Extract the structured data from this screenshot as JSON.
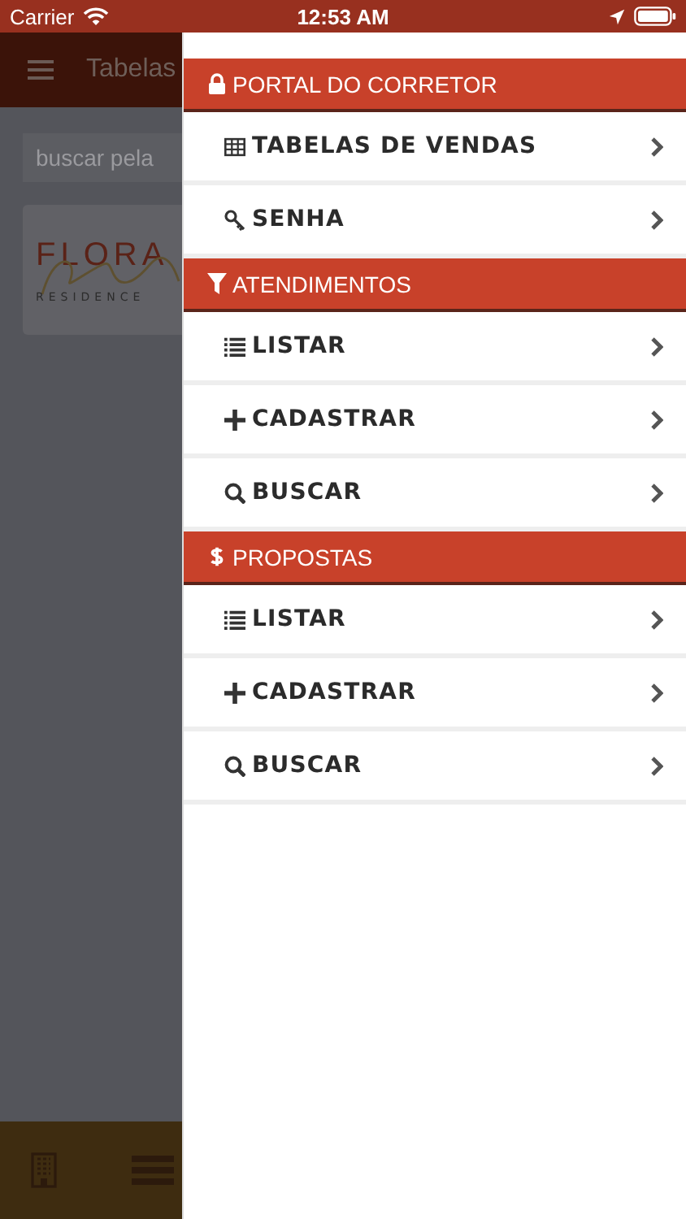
{
  "status_bar": {
    "carrier": "Carrier",
    "time": "12:53 AM"
  },
  "nav_bar": {
    "title": "Tabelas"
  },
  "search": {
    "placeholder": "buscar pela"
  },
  "card": {
    "logo_title": "FLORA",
    "logo_subtitle": "RESIDENCE"
  },
  "tab_bar": {
    "items": [
      {
        "kind": "building"
      },
      {
        "kind": "list"
      }
    ]
  },
  "drawer": {
    "sections": [
      {
        "kind": "lock",
        "title": "PORTAL DO CORRETOR",
        "items": [
          {
            "kind": "table",
            "label": "TABELAS DE VENDAS"
          },
          {
            "kind": "key",
            "label": "SENHA"
          }
        ]
      },
      {
        "kind": "filter",
        "title": "ATENDIMENTOS",
        "items": [
          {
            "kind": "list",
            "label": "LISTAR"
          },
          {
            "kind": "plus",
            "label": "CADASTRAR"
          },
          {
            "kind": "search",
            "label": "BUSCAR"
          }
        ]
      },
      {
        "kind": "dollar",
        "title": "PROPOSTAS",
        "items": [
          {
            "kind": "list",
            "label": "LISTAR"
          },
          {
            "kind": "plus",
            "label": "CADASTRAR"
          },
          {
            "kind": "search",
            "label": "BUSCAR"
          }
        ]
      }
    ]
  }
}
